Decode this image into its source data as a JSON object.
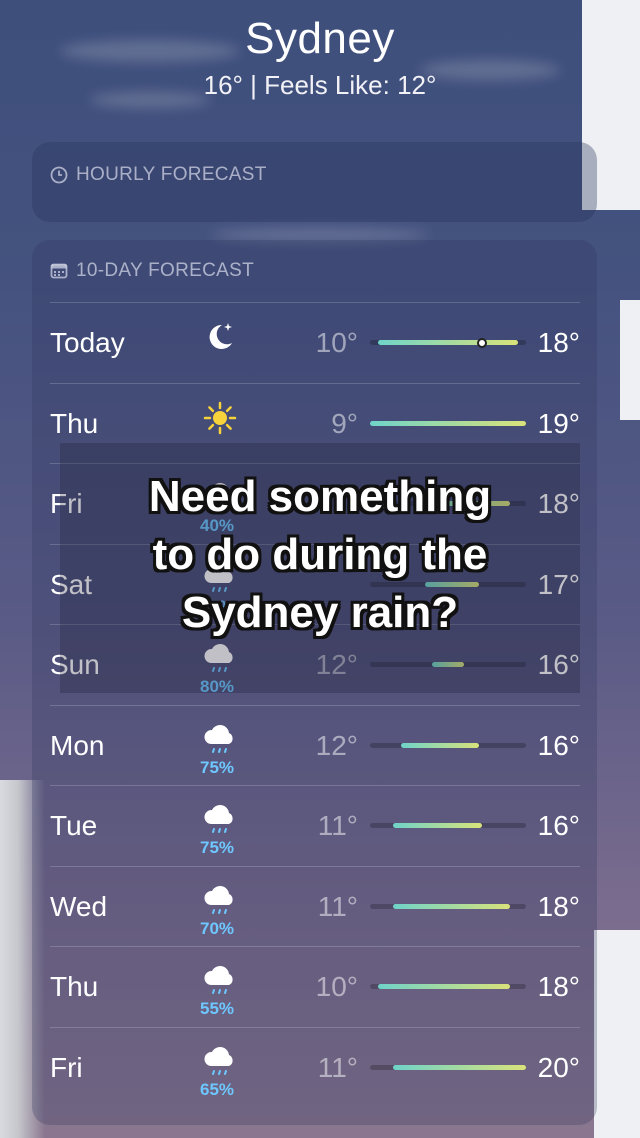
{
  "header": {
    "city": "Sydney",
    "summary": "16° | Feels Like: 12°"
  },
  "hourly": {
    "label": "HOURLY FORECAST",
    "icon": "clock-icon"
  },
  "daily": {
    "label": "10-DAY FORECAST",
    "icon": "calendar-icon",
    "days": [
      {
        "day": "Today",
        "icon": "moon-stars-icon",
        "precip": "",
        "low": "10°",
        "high": "18°",
        "range": [
          0.05,
          0.95
        ],
        "current": 0.72
      },
      {
        "day": "Thu",
        "icon": "sun-icon",
        "precip": "",
        "low": "9°",
        "high": "19°",
        "range": [
          0.0,
          1.0
        ]
      },
      {
        "day": "Fri",
        "icon": "cloud-rain-icon",
        "precip": "40%",
        "low": "",
        "high": "18°",
        "range": [
          0.35,
          0.9
        ]
      },
      {
        "day": "Sat",
        "icon": "cloud-rain-icon",
        "precip": "75%",
        "low": "",
        "high": "17°",
        "range": [
          0.35,
          0.7
        ]
      },
      {
        "day": "Sun",
        "icon": "cloud-rain-icon",
        "precip": "80%",
        "low": "12°",
        "high": "16°",
        "range": [
          0.4,
          0.6
        ]
      },
      {
        "day": "Mon",
        "icon": "cloud-rain-icon",
        "precip": "75%",
        "low": "12°",
        "high": "16°",
        "range": [
          0.2,
          0.7
        ]
      },
      {
        "day": "Tue",
        "icon": "cloud-rain-icon",
        "precip": "75%",
        "low": "11°",
        "high": "16°",
        "range": [
          0.15,
          0.72
        ]
      },
      {
        "day": "Wed",
        "icon": "cloud-rain-icon",
        "precip": "70%",
        "low": "11°",
        "high": "18°",
        "range": [
          0.15,
          0.9
        ]
      },
      {
        "day": "Thu",
        "icon": "cloud-rain-icon",
        "precip": "55%",
        "low": "10°",
        "high": "18°",
        "range": [
          0.05,
          0.9
        ]
      },
      {
        "day": "Fri",
        "icon": "cloud-rain-icon",
        "precip": "65%",
        "low": "11°",
        "high": "20°",
        "range": [
          0.15,
          1.0
        ]
      }
    ]
  },
  "overlay": {
    "lines": [
      "Need something",
      "to do during the",
      "Sydney rain?"
    ]
  },
  "colors": {
    "bar_cool": "#6fd3c9",
    "bar_warm": "#d9e27a",
    "precip": "#6ec7ff"
  }
}
